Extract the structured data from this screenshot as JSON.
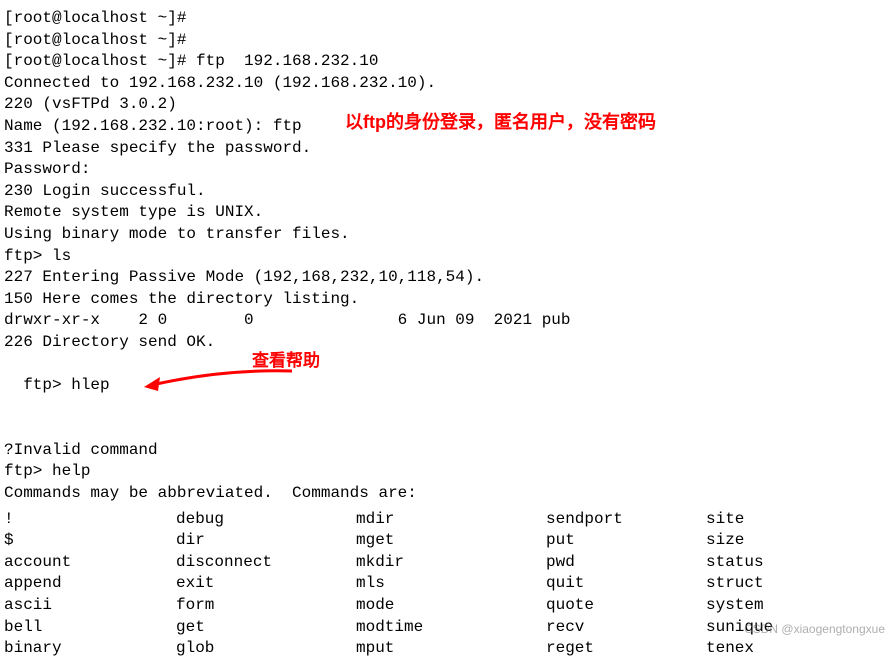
{
  "lines": {
    "l1": "[root@localhost ~]#",
    "l2": "[root@localhost ~]#",
    "l3": "[root@localhost ~]# ftp  192.168.232.10",
    "l4": "Connected to 192.168.232.10 (192.168.232.10).",
    "l5": "220 (vsFTPd 3.0.2)",
    "l6": "Name (192.168.232.10:root): ftp",
    "l7": "331 Please specify the password.",
    "l8": "Password:",
    "l9": "230 Login successful.",
    "l10": "Remote system type is UNIX.",
    "l11": "Using binary mode to transfer files.",
    "l12": "ftp> ls",
    "l13": "227 Entering Passive Mode (192,168,232,10,118,54).",
    "l14": "150 Here comes the directory listing.",
    "l15": "drwxr-xr-x    2 0        0               6 Jun 09  2021 pub",
    "l16": "226 Directory send OK.",
    "l17": "ftp> hlep",
    "l18": "?Invalid command",
    "l19": "ftp> help",
    "l20": "Commands may be abbreviated.  Commands are:",
    "blank": ""
  },
  "annotations": {
    "a1": "以ftp的身份登录，匿名用户，没有密码",
    "a2": "查看帮助"
  },
  "commands": {
    "rows": [
      {
        "c1": "!",
        "c2": "debug",
        "c3": "mdir",
        "c4": "sendport",
        "c5": "site"
      },
      {
        "c1": "$",
        "c2": "dir",
        "c3": "mget",
        "c4": "put",
        "c5": "size"
      },
      {
        "c1": "account",
        "c2": "disconnect",
        "c3": "mkdir",
        "c4": "pwd",
        "c5": "status"
      },
      {
        "c1": "append",
        "c2": "exit",
        "c3": "mls",
        "c4": "quit",
        "c5": "struct"
      },
      {
        "c1": "ascii",
        "c2": "form",
        "c3": "mode",
        "c4": "quote",
        "c5": "system"
      },
      {
        "c1": "bell",
        "c2": "get",
        "c3": "modtime",
        "c4": "recv",
        "c5": "sunique"
      },
      {
        "c1": "binary",
        "c2": "glob",
        "c3": "mput",
        "c4": "reget",
        "c5": "tenex"
      }
    ]
  },
  "watermark": "CSDN @xiaogengtongxue"
}
